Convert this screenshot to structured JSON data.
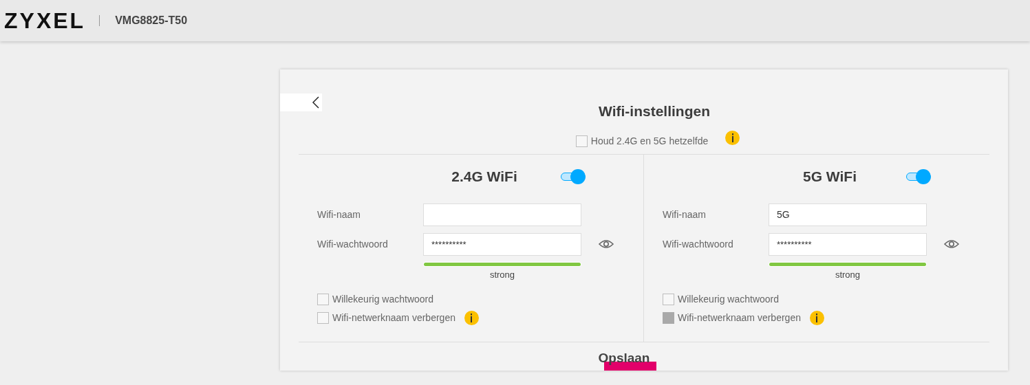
{
  "header": {
    "logo": "ZYXEL",
    "model": "VMG8825-T50"
  },
  "card": {
    "title": "Wifi-instellingen",
    "same_setting": {
      "label": "Houd 2.4G en 5G hetzelfde",
      "checked": false
    },
    "bands": [
      {
        "title": "2.4G WiFi",
        "on": true,
        "name_label": "Wifi-naam",
        "password_label": "Wifi-wachtwoord",
        "password_value": "**********",
        "strength": {
          "level": 1,
          "label": "strong"
        },
        "random_password": {
          "label": "Willekeurig wachtwoord",
          "checked": false
        },
        "hide_ssid": {
          "label": "Wifi-netwerknaam verbergen",
          "checked": false
        }
      },
      {
        "title": "5G WiFi",
        "on": true,
        "name_label": "Wifi-naam",
        "name_value": "5G",
        "password_label": "Wifi-wachtwoord",
        "password_value": "**********",
        "strength": {
          "level": 1,
          "label": "strong"
        },
        "random_password": {
          "label": "Willekeurig wachtwoord",
          "checked": false
        },
        "hide_ssid": {
          "label": "Wifi-netwerknaam verbergen",
          "checked": true
        }
      }
    ],
    "save_button": "Opslaan"
  }
}
